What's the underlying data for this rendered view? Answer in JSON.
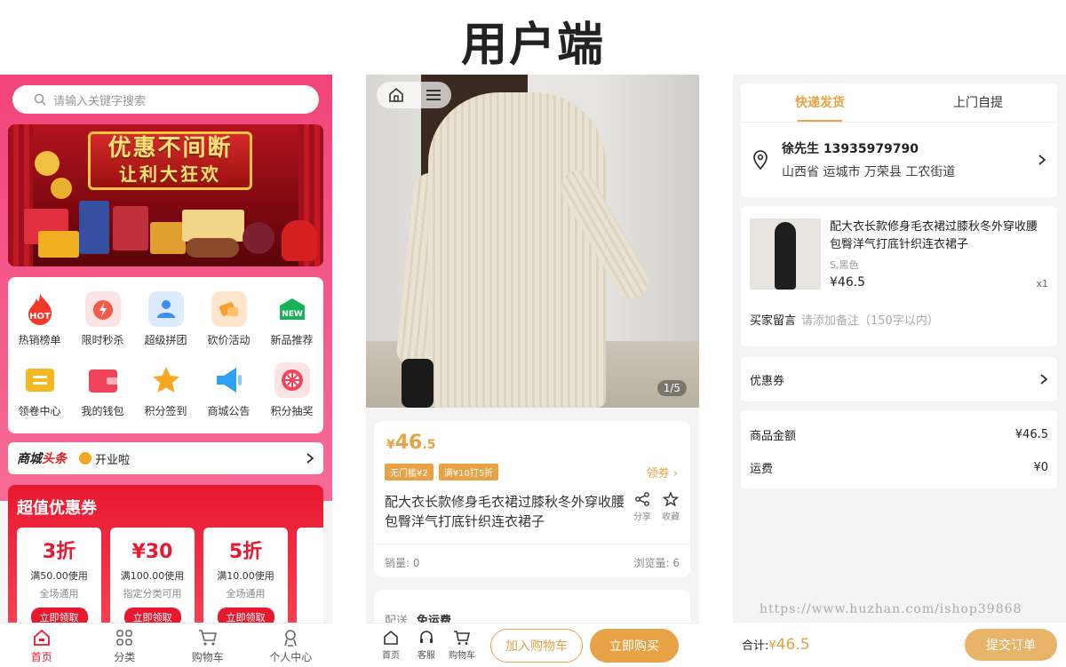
{
  "page_title": "用户端",
  "home": {
    "search_placeholder": "请输入关键字搜索",
    "banner": {
      "line1": "优惠不间断",
      "line2": "让利大狂欢"
    },
    "grid": [
      {
        "label": "热销榜单",
        "icon": "hot-icon",
        "badge": "HOT"
      },
      {
        "label": "限时秒杀",
        "icon": "flash-sale-icon"
      },
      {
        "label": "超级拼团",
        "icon": "group-buy-icon"
      },
      {
        "label": "砍价活动",
        "icon": "bargain-icon"
      },
      {
        "label": "新品推荐",
        "icon": "new-icon",
        "badge": "NEW"
      },
      {
        "label": "领卷中心",
        "icon": "coupon-center-icon"
      },
      {
        "label": "我的钱包",
        "icon": "wallet-icon"
      },
      {
        "label": "积分签到",
        "icon": "star-icon"
      },
      {
        "label": "商城公告",
        "icon": "announcement-icon"
      },
      {
        "label": "积分抽奖",
        "icon": "lottery-icon"
      }
    ],
    "news": {
      "logo_a": "商城",
      "logo_b": "头条",
      "text": "开业啦"
    },
    "coupons": {
      "title": "超值优惠券",
      "items": [
        {
          "big": "3折",
          "cond": "满50.00使用",
          "scope": "全场通用",
          "btn": "立即领取"
        },
        {
          "big": "¥30",
          "cond": "满100.00使用",
          "scope": "指定分类可用",
          "btn": "立即领取"
        },
        {
          "big": "5折",
          "cond": "满10.00使用",
          "scope": "全场通用",
          "btn": "立即领取"
        }
      ]
    },
    "tabbar": [
      "首页",
      "分类",
      "购物车",
      "个人中心"
    ]
  },
  "product": {
    "pager": "1/5",
    "price_symbol": "¥",
    "price_int": "46",
    "price_dec": ".5",
    "tags": [
      "无门槛¥2",
      "满¥10打5折"
    ],
    "get_coupon": "领券",
    "name": "配大衣长款修身毛衣裙过膝秋冬外穿收腰包臀洋气打底针织连衣裙子",
    "share": "分享",
    "favorite": "收藏",
    "sales": "销量: 0",
    "views": "浏览量: 6",
    "delivery_label": "配送",
    "delivery_value": "免运费",
    "bar": {
      "home": "首页",
      "service": "客服",
      "cart": "购物车",
      "add_cart": "加入购物车",
      "buy_now": "立即购买"
    }
  },
  "checkout": {
    "tabs": [
      "快递发货",
      "上门自提"
    ],
    "address": {
      "name_phone": "徐先生 13935979790",
      "detail": "山西省 运城市 万荣县 工农街道"
    },
    "item": {
      "name": "配大衣长款修身毛衣裙过膝秋冬外穿收腰包臀洋气打底针织连衣裙子",
      "sku": "S,黑色",
      "price": "¥46.5",
      "qty": "x1"
    },
    "message_label": "买家留言",
    "message_placeholder": "请添加备注（150字以内）",
    "coupon_label": "优惠券",
    "goods_amount_label": "商品金额",
    "goods_amount": "¥46.5",
    "shipping_label": "运费",
    "shipping": "¥0",
    "total_label": "合计:",
    "total_symbol": "¥",
    "total_value": "46.5",
    "submit": "提交订单",
    "watermark": "https://www.huzhan.com/ishop39868"
  },
  "colors": {
    "pink": "#f2447a",
    "red": "#e8182f",
    "gold": "#e8a246"
  }
}
